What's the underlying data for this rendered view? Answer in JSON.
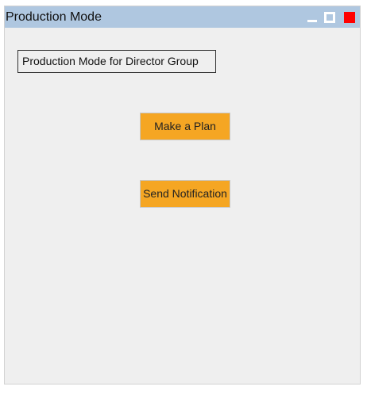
{
  "window": {
    "title": "Production Mode"
  },
  "window_controls": {
    "minimize_icon": "minimize-icon",
    "maximize_icon": "maximize-icon",
    "close_icon": "close-icon"
  },
  "main": {
    "group_label": "Production Mode for Director Group",
    "make_plan_label": "Make a Plan",
    "send_notification_label": "Send Notification"
  },
  "colors": {
    "titlebar": "#afc7e0",
    "window_background": "#efefef",
    "button_background": "#f5a623",
    "close_button": "#ff0000"
  }
}
